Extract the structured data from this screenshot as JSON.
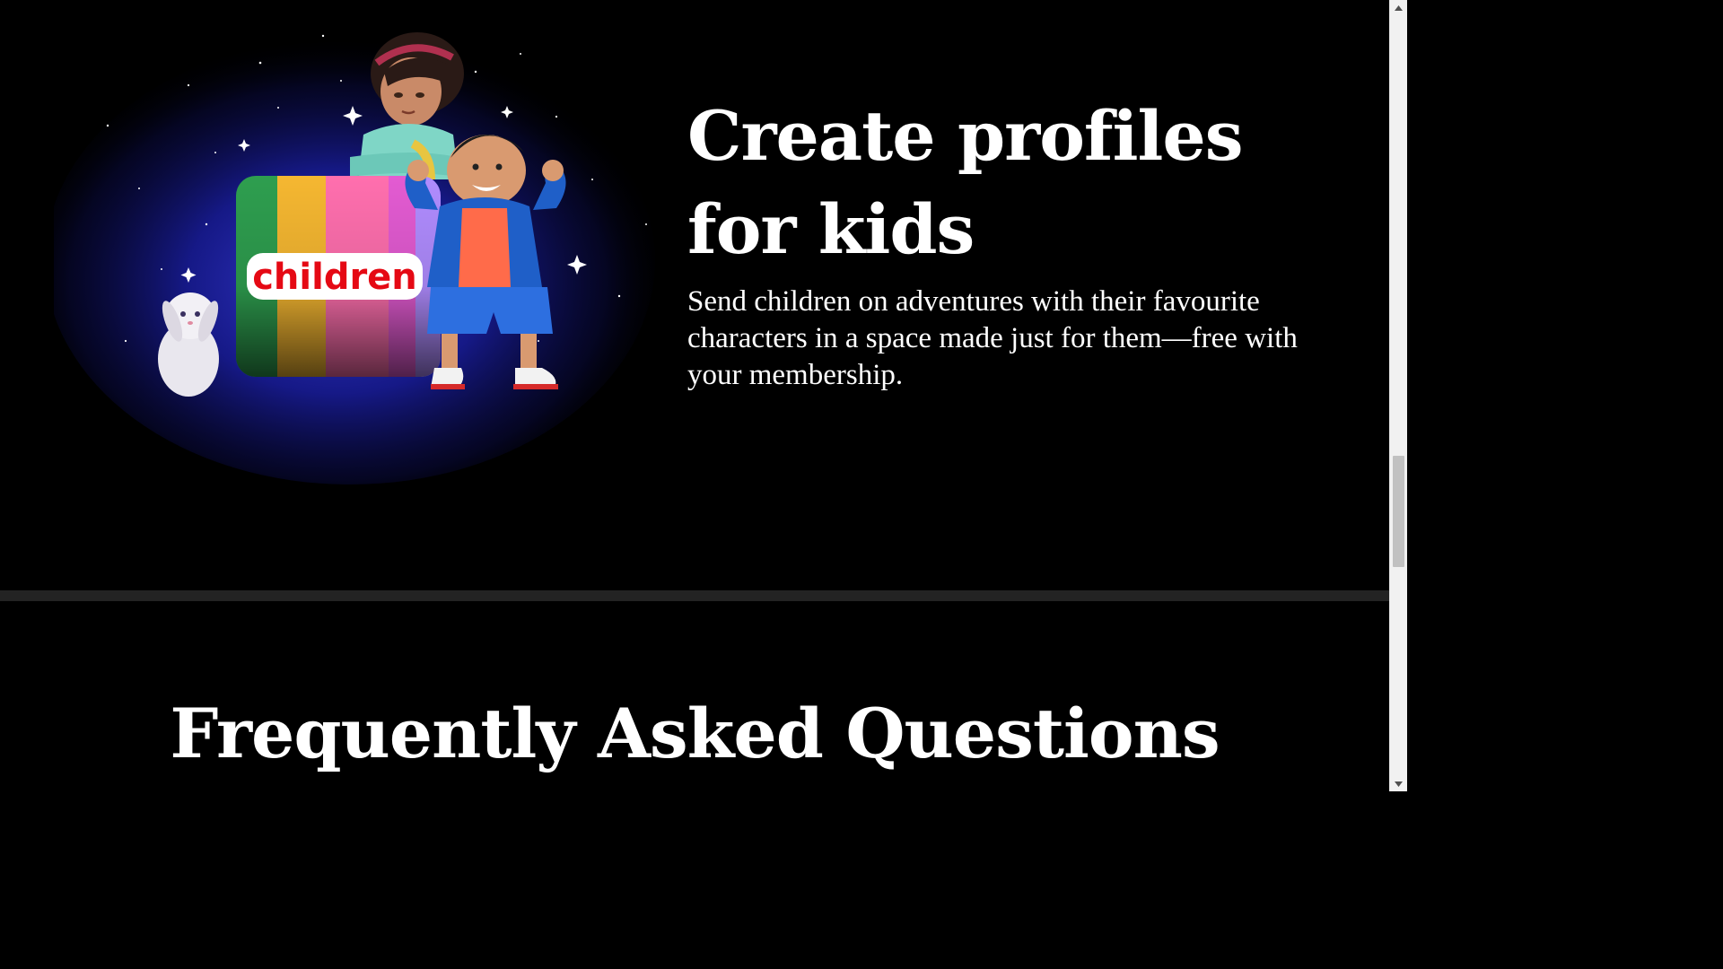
{
  "feature": {
    "title": "Create profiles for kids",
    "body": "Send children on adventures with their favourite characters in a space made just for them—free with your membership.",
    "illustration": {
      "badge_text": "children",
      "badge_stripe_colors": [
        "#2e9e4f",
        "#f5b731",
        "#ff6fae",
        "#e35bd2",
        "#b08cff"
      ],
      "glow_color": "#1b1fa8"
    }
  },
  "faq": {
    "heading": "Frequently Asked Questions"
  },
  "scrollbar": {
    "up_icon": "scroll-up-arrow-icon",
    "down_icon": "scroll-down-arrow-icon"
  },
  "colors": {
    "background": "#000000",
    "divider": "#232323",
    "text": "#ffffff",
    "badge_text": "#e50914"
  }
}
